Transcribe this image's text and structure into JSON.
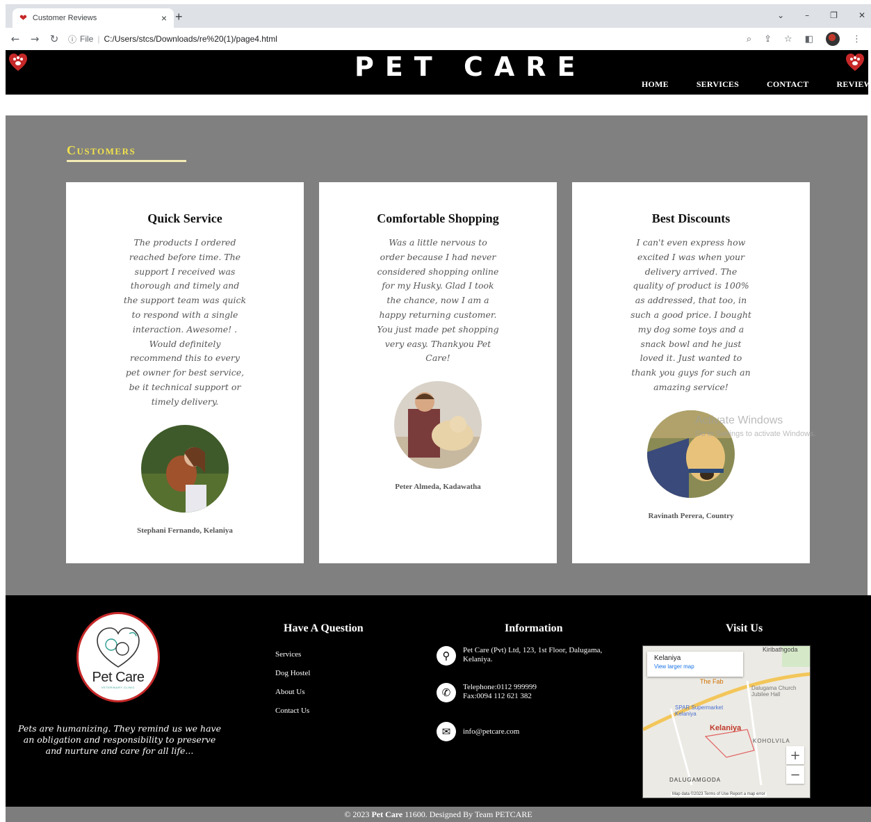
{
  "browser": {
    "tab_title": "Customer Reviews",
    "tab_close": "×",
    "new_tab": "+",
    "url_scheme": "File",
    "url": "C:/Users/stcs/Downloads/re%20(1)/page4.html"
  },
  "site": {
    "brand": "PET CARE",
    "nav": [
      "HOME",
      "SERVICES",
      "CONTACT",
      "REVIEWS"
    ]
  },
  "customers": {
    "section_title": "Customers",
    "cards": [
      {
        "title": "Quick Service",
        "text": "The products I ordered reached before time. The support I received was thorough and timely and the support team was quick to respond with a single interaction. Awesome! . Would definitely recommend this to every pet owner for best service, be it technical support or timely delivery.",
        "author": "Stephani Fernando, Kelaniya"
      },
      {
        "title": "Comfortable Shopping",
        "text": "Was a little nervous to order because I had never considered shopping online for my Husky. Glad I took the chance, now I am a happy returning customer. You just made pet shopping very easy. Thankyou Pet Care!",
        "author": "Peter Almeda, Kadawatha"
      },
      {
        "title": "Best Discounts",
        "text": "I can't even express how excited I was when your delivery arrived. The quality of product is 100% as addressed, that too, in such a good price. I bought my dog some toys and a snack bowl and he just loved it. Just wanted to thank you guys for such an amazing service!",
        "author": "Ravinath Perera, Country"
      }
    ]
  },
  "footer": {
    "logo_text": "Pet Care",
    "logo_sub": "VETERINARY CLINIC",
    "quote": "Pets are humanizing. They remind us we have an obligation and responsibility to preserve and nurture and care for all life...",
    "question_title": "Have A Question",
    "links": [
      "Services",
      "Dog Hostel",
      "About Us",
      "Contact Us"
    ],
    "info_title": "Information",
    "address": "Pet Care (Pvt) Ltd, 123, 1st Floor,   Dalugama, Kelaniya.",
    "telephone": "Telephone:0112 999999",
    "fax": "Fax:0094 112 621 382",
    "email": "info@petcare.com",
    "visit_title": "Visit Us",
    "map": {
      "place": "Kelaniya",
      "link": "View larger map",
      "labels": {
        "kiribathgoda": "Kiribathgoda",
        "the_fab": "The Fab",
        "church": "Dalugama Church Jubilee Hall",
        "spar": "SPAR Supermarket Kelaniya",
        "kelaniya": "Kelaniya",
        "koholvila": "KOHOLVILA",
        "dalugamgoda": "DALUGAMGODA"
      },
      "attribution": "Map data ©2023   Terms of Use   Report a map error"
    },
    "copyright_prefix": "© 2023 ",
    "copyright_brand": "Pet Care",
    "copyright_suffix": " 11600. Designed By Team PETCARE"
  },
  "os_watermark": {
    "line1": "Activate Windows",
    "line2": "Go to Settings to activate Windows."
  },
  "colors": {
    "section_bg": "#808080",
    "title_yellow": "#f1e14c",
    "header_bg": "#000000",
    "heart_red": "#c62828"
  }
}
